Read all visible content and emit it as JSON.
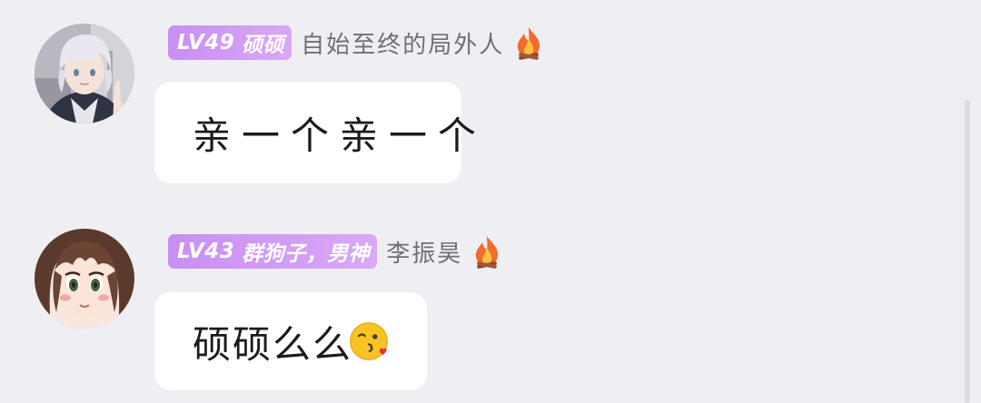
{
  "messages": [
    {
      "level": "LV49",
      "title": "硕硕",
      "username": "自始至终的局外人",
      "badge_icon": "fire-icon",
      "text": "亲一个亲一个",
      "emoji": "",
      "avatar": "anime-boy-white-hair"
    },
    {
      "level": "LV43",
      "title": "群狗子，男神",
      "username": "李振昊",
      "badge_icon": "fire-icon",
      "text": "硕硕么么",
      "emoji": "kissing-face-emoji",
      "avatar": "anime-girl-brown-hair"
    }
  ],
  "colors": {
    "background": "#efeef2",
    "tag_gradient_start": "#c88ff2",
    "tag_gradient_end": "#d9a8f6",
    "bubble": "#ffffff",
    "username": "#6f6f75"
  }
}
